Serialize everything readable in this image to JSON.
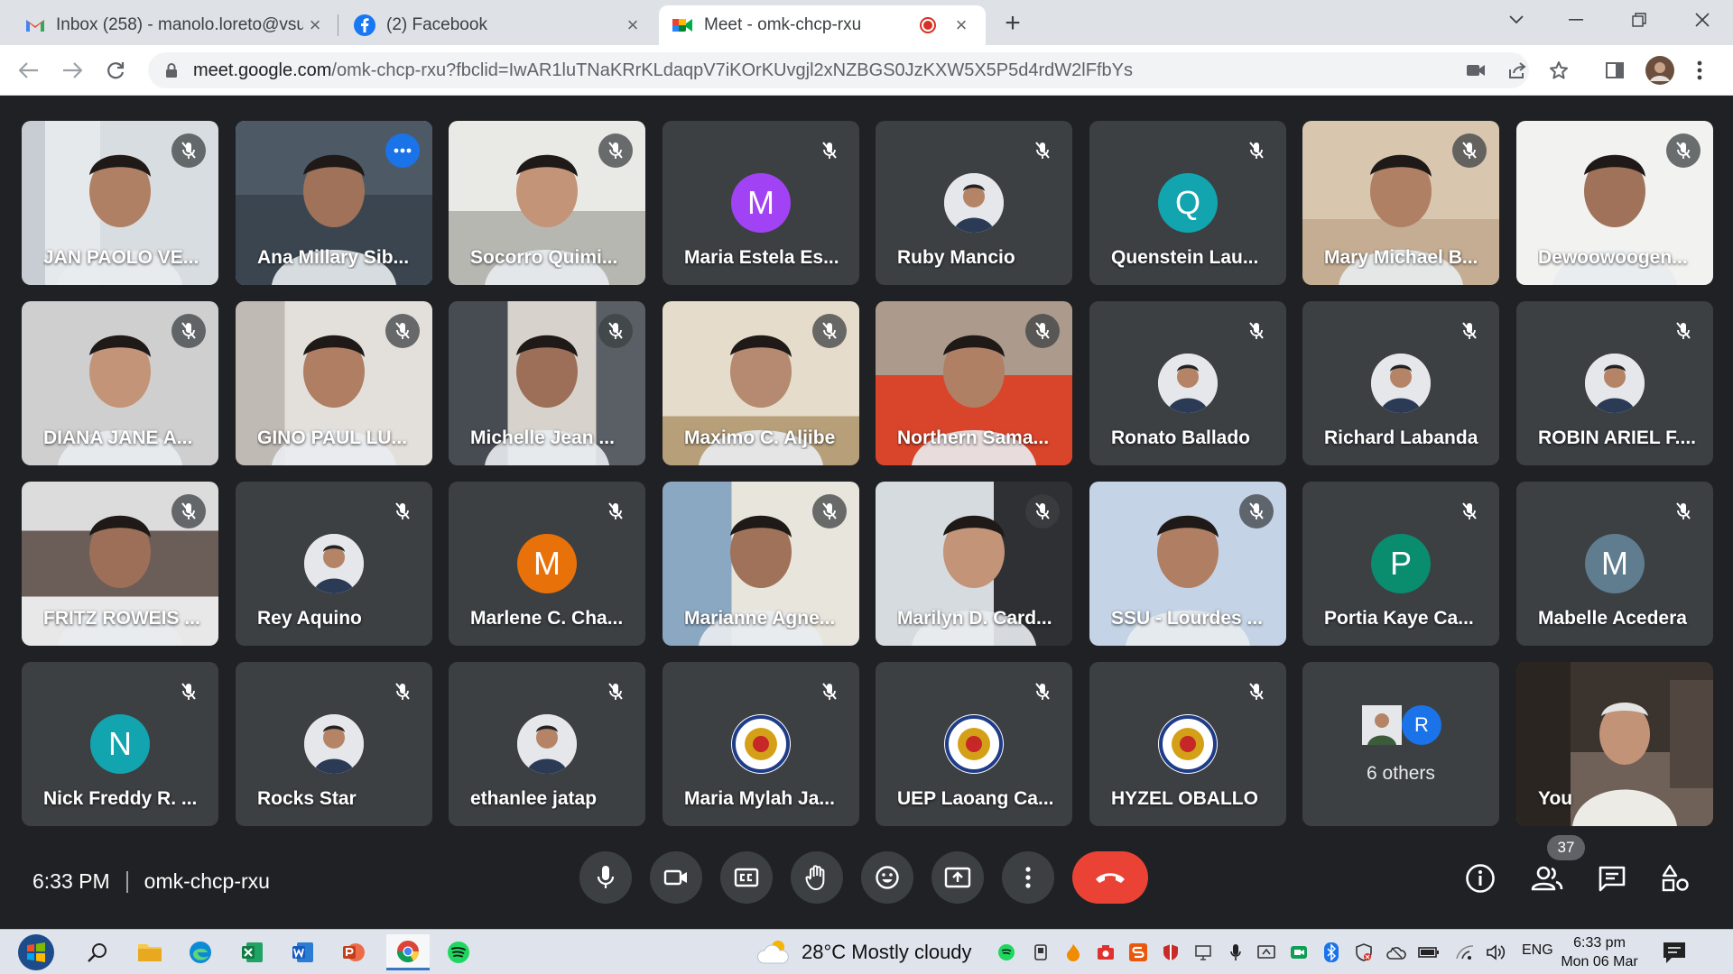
{
  "browser": {
    "tabs": [
      {
        "title": "Inbox (258) - manolo.loreto@vsu",
        "icon": "gmail-icon"
      },
      {
        "title": "(2) Facebook",
        "icon": "facebook-icon"
      },
      {
        "title": "Meet - omk-chcp-rxu",
        "icon": "meet-icon",
        "active": true
      }
    ],
    "url_host": "meet.google.com",
    "url_path": "/omk-chcp-rxu?fbclid=IwAR1luTNaKRrKLdaqpV7iKOrKUvgjl2xNZBGS0JzKXW5X5P5d4rdW2lFfbYs"
  },
  "meet": {
    "meeting_code": "omk-chcp-rxu",
    "time": "6:33 PM",
    "participant_count": "37",
    "avatar_colors": {
      "purple": "#a142f4",
      "teal": "#12a4af",
      "orange": "#e8710a",
      "green": "#0a8c6f",
      "grey": "#5f7d8e",
      "blue": "#1a73e8"
    },
    "participants": [
      {
        "name": "JAN PAOLO VE...",
        "type": "video"
      },
      {
        "name": "Ana Millary Sib...",
        "type": "video",
        "speaking": true
      },
      {
        "name": "Socorro Quimi...",
        "type": "video"
      },
      {
        "name": "Maria Estela Es...",
        "type": "avatar",
        "initial": "M",
        "color": "#a142f4"
      },
      {
        "name": "Ruby Mancio",
        "type": "photo"
      },
      {
        "name": "Quenstein Lau...",
        "type": "avatar",
        "initial": "Q",
        "color": "#12a4af"
      },
      {
        "name": "Mary Michael B...",
        "type": "video"
      },
      {
        "name": "Dewoowoogen...",
        "type": "video"
      },
      {
        "name": "DIANA JANE A...",
        "type": "video"
      },
      {
        "name": "GINO PAUL LU...",
        "type": "video"
      },
      {
        "name": "Michelle Jean ...",
        "type": "video"
      },
      {
        "name": "Maximo C. Aljibe",
        "type": "video"
      },
      {
        "name": "Northern Sama...",
        "type": "video"
      },
      {
        "name": "Ronato Ballado",
        "type": "photo"
      },
      {
        "name": "Richard Labanda",
        "type": "photo"
      },
      {
        "name": "ROBIN ARIEL F....",
        "type": "photo"
      },
      {
        "name": "FRITZ ROWEIS ...",
        "type": "video"
      },
      {
        "name": "Rey Aquino",
        "type": "photo"
      },
      {
        "name": "Marlene C. Cha...",
        "type": "avatar",
        "initial": "M",
        "color": "#e8710a"
      },
      {
        "name": "Marianne Agne...",
        "type": "video"
      },
      {
        "name": "Marilyn D. Card...",
        "type": "video"
      },
      {
        "name": "SSU - Lourdes ...",
        "type": "video"
      },
      {
        "name": "Portia Kaye Ca...",
        "type": "avatar",
        "initial": "P",
        "color": "#0a8c6f"
      },
      {
        "name": "Mabelle Acedera",
        "type": "avatar",
        "initial": "M",
        "color": "#5f7d8e"
      },
      {
        "name": "Nick Freddy R. ...",
        "type": "avatar",
        "initial": "N",
        "color": "#12a4af"
      },
      {
        "name": "Rocks Star",
        "type": "photo"
      },
      {
        "name": "ethanlee jatap",
        "type": "photo"
      },
      {
        "name": "Maria Mylah Ja...",
        "type": "logo"
      },
      {
        "name": "UEP Laoang Ca...",
        "type": "logo"
      },
      {
        "name": "HYZEL OBALLO",
        "type": "logo"
      }
    ],
    "others": {
      "label": "6 others",
      "initial": "R"
    },
    "self_label": "You"
  },
  "taskbar": {
    "weather": "28°C  Mostly cloudy",
    "lang": "ENG",
    "time": "6:33 pm",
    "date": "Mon 06 Mar"
  }
}
